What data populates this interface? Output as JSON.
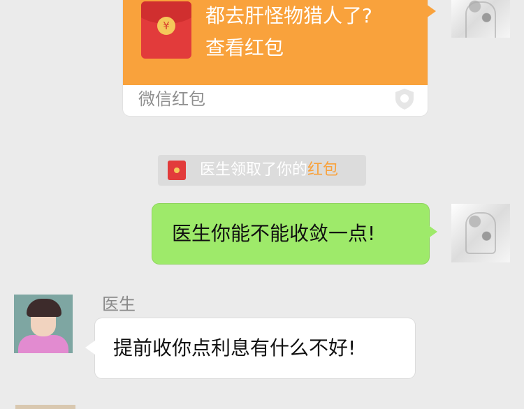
{
  "red_packet": {
    "title": "都去肝怪物猎人了?",
    "subtitle": "查看红包",
    "footer": "微信红包",
    "coin_symbol": "¥",
    "color": "#f9a23c"
  },
  "notice": {
    "prefix": "医生领取了你的",
    "link": "红包"
  },
  "messages": {
    "self_text": "医生你能不能收敛一点!",
    "doctor_name": "医生",
    "doctor_text": "提前收你点利息有什么不好!"
  },
  "colors": {
    "background": "#ebebeb",
    "self_bubble": "#9eea6a",
    "other_bubble": "#ffffff"
  }
}
